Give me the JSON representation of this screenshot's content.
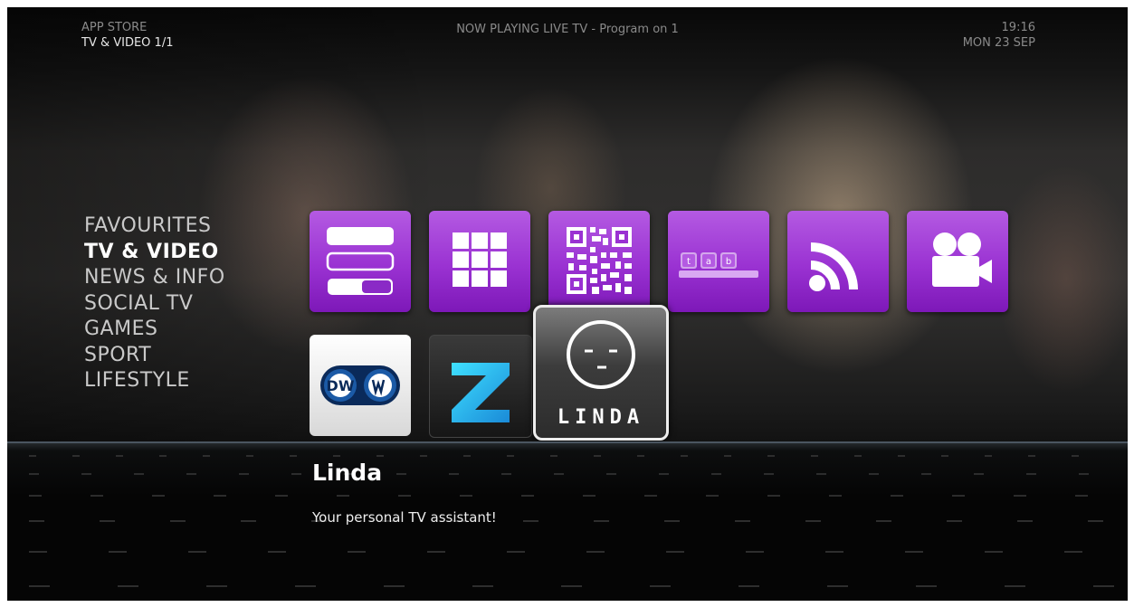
{
  "header": {
    "section": "APP STORE",
    "category": "TV & VIDEO 1/1",
    "now_playing": "NOW PLAYING LIVE TV - Program on 1",
    "time": "19:16",
    "date": "MON 23 SEP"
  },
  "menu": {
    "items": [
      {
        "label": "FAVOURITES",
        "active": false
      },
      {
        "label": "TV & VIDEO",
        "active": true
      },
      {
        "label": "NEWS & INFO",
        "active": false
      },
      {
        "label": "SOCIAL TV",
        "active": false
      },
      {
        "label": "GAMES",
        "active": false
      },
      {
        "label": "SPORT",
        "active": false
      },
      {
        "label": "LIFESTYLE",
        "active": false
      }
    ]
  },
  "apps": {
    "row1": [
      {
        "icon": "settings-panel-icon"
      },
      {
        "icon": "grid-icon"
      },
      {
        "icon": "qr-code-icon"
      },
      {
        "icon": "tab-icon",
        "text": [
          "t",
          "a",
          "b"
        ]
      },
      {
        "icon": "rss-icon"
      },
      {
        "icon": "video-camera-icon"
      }
    ],
    "row2": [
      {
        "icon": "dw-logo-icon",
        "logo_text": "DW"
      },
      {
        "icon": "zattoo-logo-icon",
        "logo_text": "Z"
      },
      {
        "icon": "linda-face-icon",
        "label": "LINDA",
        "selected": true
      }
    ]
  },
  "detail": {
    "title": "Linda",
    "description": "Your personal TV assistant!"
  },
  "colors": {
    "tile_purple": "#9a32d2",
    "background": "#050505",
    "selection_border": "#ededed"
  }
}
